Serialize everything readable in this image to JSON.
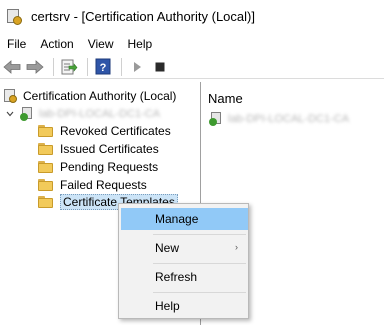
{
  "window": {
    "title": "certsrv - [Certification Authority (Local)]"
  },
  "menubar": {
    "items": [
      "File",
      "Action",
      "View",
      "Help"
    ]
  },
  "toolbar": {
    "buttons": [
      "back-arrow-icon",
      "forward-arrow-icon",
      "export-list-icon",
      "help-icon",
      "play-icon",
      "stop-icon"
    ]
  },
  "tree": {
    "root_label": "Certification Authority (Local)",
    "ca_name_blurred": "lab-DPI-LOCAL-DC1-CA",
    "folders": [
      "Revoked Certificates",
      "Issued Certificates",
      "Pending Requests",
      "Failed Requests",
      "Certificate Templates"
    ]
  },
  "right_pane": {
    "column_header": "Name",
    "row_blurred": "lab-DPI-LOCAL-DC1-CA"
  },
  "context_menu": {
    "items": [
      "Manage",
      "New",
      "Refresh",
      "Help"
    ],
    "hovered": "Manage"
  },
  "colors": {
    "selection": "#cce4f7",
    "menu_hover": "#91c9f7",
    "folder": "#f2ca5a"
  }
}
